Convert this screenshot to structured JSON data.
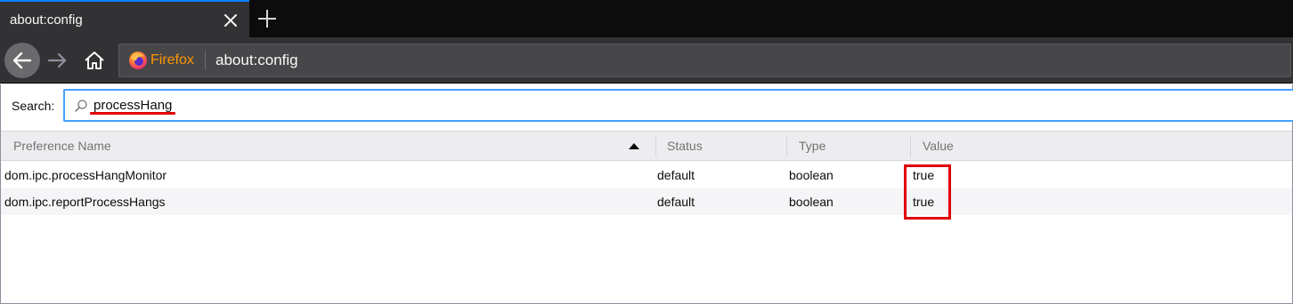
{
  "tab": {
    "title": "about:config"
  },
  "urlbar": {
    "identity_label": "Firefox",
    "url": "about:config"
  },
  "search": {
    "label": "Search:",
    "value": "processHang"
  },
  "table": {
    "columns": [
      "Preference Name",
      "Status",
      "Type",
      "Value"
    ],
    "sort": {
      "column": "Preference Name",
      "direction": "ascending"
    },
    "rows": [
      {
        "name": "dom.ipc.processHangMonitor",
        "status": "default",
        "type": "boolean",
        "value": "true"
      },
      {
        "name": "dom.ipc.reportProcessHangs",
        "status": "default",
        "type": "boolean",
        "value": "true"
      }
    ]
  },
  "colors": {
    "accent": "#0a84ff",
    "firefox_orange": "#ff9400",
    "annotation_red": "#e00000"
  },
  "icons": [
    "close-icon",
    "plus-icon",
    "back-arrow-icon",
    "forward-arrow-icon",
    "home-icon",
    "firefox-logo-icon",
    "search-icon",
    "sort-ascending-icon"
  ]
}
